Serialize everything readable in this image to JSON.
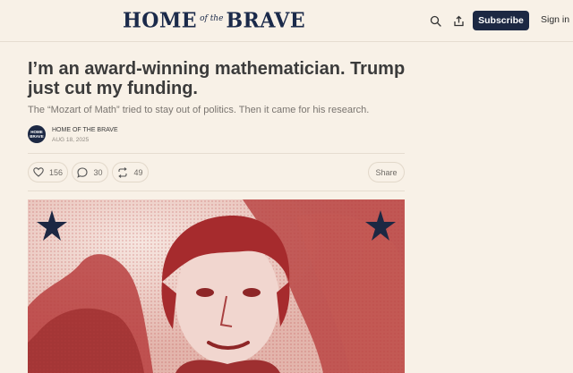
{
  "header": {
    "logo_home": "HOME",
    "logo_ofthe": "of the",
    "logo_brave": "BRAVE",
    "subscribe_label": "Subscribe",
    "signin_label": "Sign in",
    "search_icon": "search-icon",
    "share_icon": "share-icon"
  },
  "article": {
    "title": "I’m an award-winning mathematician. Trump just cut my funding.",
    "subtitle": "The “Mozart of Math” tried to stay out of politics. Then it came for his research.",
    "avatar_line1": "HOME",
    "avatar_line2": "BRAVE",
    "author": "HOME OF THE BRAVE",
    "date": "AUG 18, 2025"
  },
  "actions": {
    "likes": "156",
    "comments": "30",
    "restacks": "49",
    "share_label": "Share"
  },
  "colors": {
    "background": "#f8f1e7",
    "brand_navy": "#1c2843",
    "hero_red": "#b8403f"
  }
}
